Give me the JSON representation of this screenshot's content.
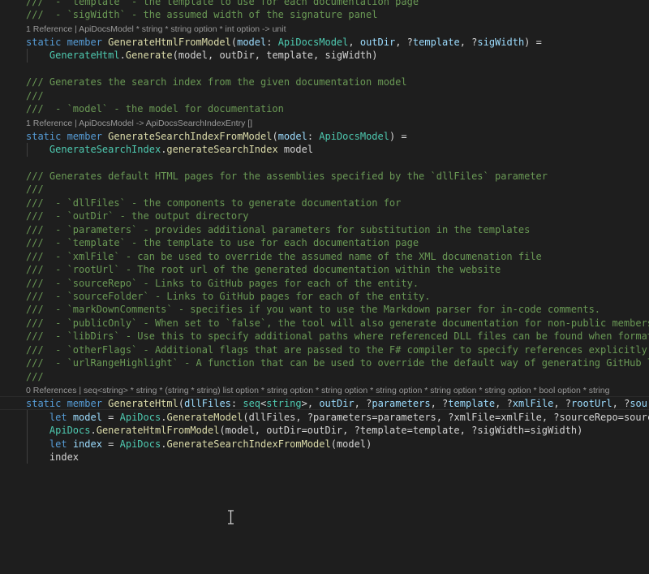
{
  "colors": {
    "background": "#1e1e1e",
    "comment": "#6a9955",
    "keyword": "#569cd6",
    "function": "#dcdcaa",
    "type": "#4ec9b0",
    "identifier": "#9cdcfe",
    "plain": "#d4d4d4",
    "codelens": "#999999"
  },
  "cursor_icon": "text-ibeam-icon",
  "editor": {
    "lines": [
      {
        "kind": "code",
        "name": "code-line-1",
        "tokens": [
          {
            "t": "comment",
            "v": "///  - `template` - the template to use for each documentation page"
          }
        ]
      },
      {
        "kind": "code",
        "name": "code-line-2",
        "tokens": [
          {
            "t": "comment",
            "v": "///  - `sigWidth` - the assumed width of the signature panel"
          }
        ]
      },
      {
        "kind": "lens",
        "name": "codelens-references",
        "text": "1 Reference | ApiDocsModel * string * string option * int option -> unit"
      },
      {
        "kind": "code",
        "name": "code-line-3",
        "tokens": [
          {
            "t": "kw",
            "v": "static member "
          },
          {
            "t": "fn",
            "v": "GenerateHtmlFromModel"
          },
          {
            "t": "plain",
            "v": "("
          },
          {
            "t": "id",
            "v": "model"
          },
          {
            "t": "plain",
            "v": ": "
          },
          {
            "t": "type",
            "v": "ApiDocsModel"
          },
          {
            "t": "plain",
            "v": ", "
          },
          {
            "t": "id",
            "v": "outDir"
          },
          {
            "t": "plain",
            "v": ", ?"
          },
          {
            "t": "id",
            "v": "template"
          },
          {
            "t": "plain",
            "v": ", ?"
          },
          {
            "t": "id",
            "v": "sigWidth"
          },
          {
            "t": "plain",
            "v": ") ="
          }
        ]
      },
      {
        "kind": "code",
        "name": "code-line-4",
        "tokens": [
          {
            "t": "plain",
            "v": "    "
          },
          {
            "t": "type",
            "v": "GenerateHtml"
          },
          {
            "t": "plain",
            "v": "."
          },
          {
            "t": "fn",
            "v": "Generate"
          },
          {
            "t": "plain",
            "v": "(model, outDir, template, sigWidth)"
          }
        ]
      },
      {
        "kind": "code",
        "name": "code-line-5",
        "tokens": []
      },
      {
        "kind": "code",
        "name": "code-line-6",
        "tokens": [
          {
            "t": "comment",
            "v": "/// Generates the search index from the given documentation model"
          }
        ]
      },
      {
        "kind": "code",
        "name": "code-line-7",
        "tokens": [
          {
            "t": "comment",
            "v": "///"
          }
        ]
      },
      {
        "kind": "code",
        "name": "code-line-8",
        "tokens": [
          {
            "t": "comment",
            "v": "///  - `model` - the model for documentation"
          }
        ]
      },
      {
        "kind": "lens",
        "name": "codelens-references",
        "text": "1 Reference | ApiDocsModel -> ApiDocsSearchIndexEntry []"
      },
      {
        "kind": "code",
        "name": "code-line-9",
        "tokens": [
          {
            "t": "kw",
            "v": "static member "
          },
          {
            "t": "fn",
            "v": "GenerateSearchIndexFromModel"
          },
          {
            "t": "plain",
            "v": "("
          },
          {
            "t": "id",
            "v": "model"
          },
          {
            "t": "plain",
            "v": ": "
          },
          {
            "t": "type",
            "v": "ApiDocsModel"
          },
          {
            "t": "plain",
            "v": ") ="
          }
        ]
      },
      {
        "kind": "code",
        "name": "code-line-10",
        "tokens": [
          {
            "t": "plain",
            "v": "    "
          },
          {
            "t": "type",
            "v": "GenerateSearchIndex"
          },
          {
            "t": "plain",
            "v": "."
          },
          {
            "t": "fn",
            "v": "generateSearchIndex"
          },
          {
            "t": "plain",
            "v": " model"
          }
        ]
      },
      {
        "kind": "code",
        "name": "code-line-11",
        "tokens": []
      },
      {
        "kind": "code",
        "name": "code-line-12",
        "tokens": [
          {
            "t": "comment",
            "v": "/// Generates default HTML pages for the assemblies specified by the `dllFiles` parameter"
          }
        ]
      },
      {
        "kind": "code",
        "name": "code-line-13",
        "tokens": [
          {
            "t": "comment",
            "v": "///"
          }
        ]
      },
      {
        "kind": "code",
        "name": "code-line-14",
        "tokens": [
          {
            "t": "comment",
            "v": "///  - `dllFiles` - the components to generate documentation for"
          }
        ]
      },
      {
        "kind": "code",
        "name": "code-line-15",
        "tokens": [
          {
            "t": "comment",
            "v": "///  - `outDir` - the output directory"
          }
        ]
      },
      {
        "kind": "code",
        "name": "code-line-16",
        "tokens": [
          {
            "t": "comment",
            "v": "///  - `parameters` - provides additional parameters for substitution in the templates"
          }
        ]
      },
      {
        "kind": "code",
        "name": "code-line-17",
        "tokens": [
          {
            "t": "comment",
            "v": "///  - `template` - the template to use for each documentation page"
          }
        ]
      },
      {
        "kind": "code",
        "name": "code-line-18",
        "tokens": [
          {
            "t": "comment",
            "v": "///  - `xmlFile` - can be used to override the assumed name of the XML documenation file"
          }
        ]
      },
      {
        "kind": "code",
        "name": "code-line-19",
        "tokens": [
          {
            "t": "comment",
            "v": "///  - `rootUrl` - The root url of the generated documentation within the website"
          }
        ]
      },
      {
        "kind": "code",
        "name": "code-line-20",
        "tokens": [
          {
            "t": "comment",
            "v": "///  - `sourceRepo` - Links to GitHub pages for each of the entity."
          }
        ]
      },
      {
        "kind": "code",
        "name": "code-line-21",
        "tokens": [
          {
            "t": "comment",
            "v": "///  - `sourceFolder` - Links to GitHub pages for each of the entity."
          }
        ]
      },
      {
        "kind": "code",
        "name": "code-line-22",
        "tokens": [
          {
            "t": "comment",
            "v": "///  - `markDownComments` - specifies if you want to use the Markdown parser for in-code comments."
          }
        ]
      },
      {
        "kind": "code",
        "name": "code-line-23",
        "tokens": [
          {
            "t": "comment",
            "v": "///  - `publicOnly` - When set to `false`, the tool will also generate documentation for non-public members"
          }
        ]
      },
      {
        "kind": "code",
        "name": "code-line-24",
        "tokens": [
          {
            "t": "comment",
            "v": "///  - `libDirs` - Use this to specify additional paths where referenced DLL files can be found when formatting code snippets"
          }
        ]
      },
      {
        "kind": "code",
        "name": "code-line-25",
        "tokens": [
          {
            "t": "comment",
            "v": "///  - `otherFlags` - Additional flags that are passed to the F# compiler to specify references explicitly etc."
          }
        ]
      },
      {
        "kind": "code",
        "name": "code-line-26",
        "tokens": [
          {
            "t": "comment",
            "v": "///  - `urlRangeHighlight` - A function that can be used to override the default way of generating GitHub links"
          }
        ]
      },
      {
        "kind": "code",
        "name": "code-line-27",
        "tokens": [
          {
            "t": "comment",
            "v": "///"
          }
        ]
      },
      {
        "kind": "lens",
        "name": "codelens-references",
        "text": "0 References | seq<string> * string * (string * string) list option * string option * string option * string option * string option * string option * bool option * string"
      },
      {
        "kind": "code",
        "name": "code-line-28",
        "tokens": [
          {
            "t": "kw",
            "v": "static member "
          },
          {
            "t": "fn",
            "v": "GenerateHtml"
          },
          {
            "t": "plain",
            "v": "("
          },
          {
            "t": "id",
            "v": "dllFiles"
          },
          {
            "t": "plain",
            "v": ": "
          },
          {
            "t": "type",
            "v": "seq"
          },
          {
            "t": "plain",
            "v": "<"
          },
          {
            "t": "type",
            "v": "string"
          },
          {
            "t": "plain",
            "v": ">, "
          },
          {
            "t": "id",
            "v": "outDir"
          },
          {
            "t": "plain",
            "v": ", ?"
          },
          {
            "t": "id",
            "v": "parameters"
          },
          {
            "t": "plain",
            "v": ", ?"
          },
          {
            "t": "id",
            "v": "template"
          },
          {
            "t": "plain",
            "v": ", ?"
          },
          {
            "t": "id",
            "v": "xmlFile"
          },
          {
            "t": "plain",
            "v": ", ?"
          },
          {
            "t": "id",
            "v": "rootUrl"
          },
          {
            "t": "plain",
            "v": ", ?"
          },
          {
            "t": "id",
            "v": "sourceRepo"
          }
        ]
      },
      {
        "kind": "code",
        "name": "code-line-29",
        "tokens": [
          {
            "t": "plain",
            "v": "    "
          },
          {
            "t": "kw",
            "v": "let "
          },
          {
            "t": "id",
            "v": "model"
          },
          {
            "t": "plain",
            "v": " = "
          },
          {
            "t": "type",
            "v": "ApiDocs"
          },
          {
            "t": "plain",
            "v": "."
          },
          {
            "t": "fn",
            "v": "GenerateModel"
          },
          {
            "t": "plain",
            "v": "(dllFiles, ?parameters=parameters, ?xmlFile=xmlFile, ?sourceRepo=sourceRepo"
          }
        ]
      },
      {
        "kind": "code",
        "name": "code-line-30",
        "tokens": [
          {
            "t": "plain",
            "v": "    "
          },
          {
            "t": "type",
            "v": "ApiDocs"
          },
          {
            "t": "plain",
            "v": "."
          },
          {
            "t": "fn",
            "v": "GenerateHtmlFromModel"
          },
          {
            "t": "plain",
            "v": "(model, outDir=outDir, ?template=template, ?sigWidth=sigWidth)"
          }
        ]
      },
      {
        "kind": "code",
        "name": "code-line-31",
        "tokens": [
          {
            "t": "plain",
            "v": "    "
          },
          {
            "t": "kw",
            "v": "let "
          },
          {
            "t": "id",
            "v": "index"
          },
          {
            "t": "plain",
            "v": " = "
          },
          {
            "t": "type",
            "v": "ApiDocs"
          },
          {
            "t": "plain",
            "v": "."
          },
          {
            "t": "fn",
            "v": "GenerateSearchIndexFromModel"
          },
          {
            "t": "plain",
            "v": "(model)"
          }
        ]
      },
      {
        "kind": "code",
        "name": "code-line-32",
        "tokens": [
          {
            "t": "plain",
            "v": "    index"
          }
        ]
      }
    ]
  }
}
